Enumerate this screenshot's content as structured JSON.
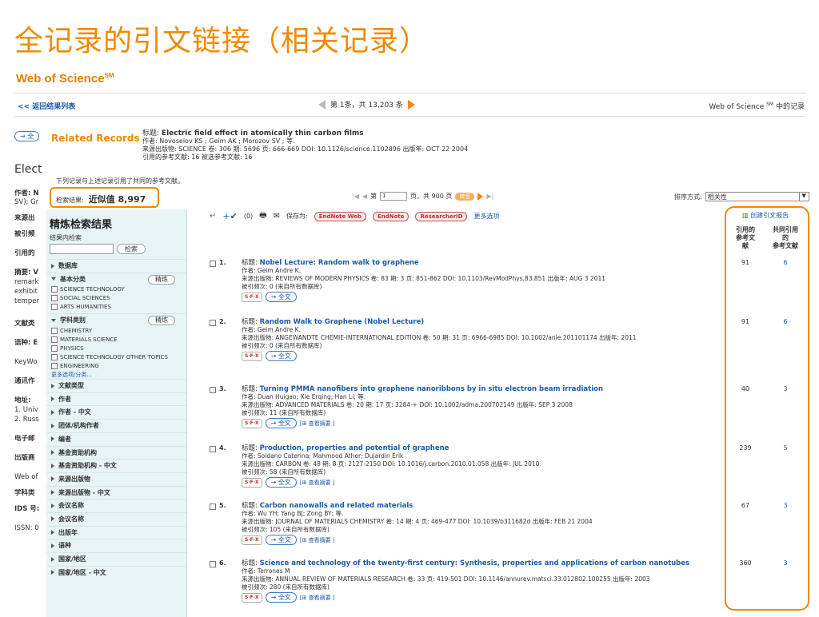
{
  "slide_title": "全记录的引文链接（相关记录）",
  "brand": {
    "name": "Web of Science",
    "mark": "SM"
  },
  "topbar": {
    "back": "<< 返回结果列表",
    "pager": "第 1条，共 13,203 条",
    "right": "Web of Science",
    "right_mark": "SM",
    "right_suffix": "中的记录"
  },
  "behind": {
    "btn": "→ 全",
    "heading": "Elect",
    "lines": [
      "作者: N",
      "SV); Gr",
      "来源出",
      "被引频",
      "引用的",
      "摘要: V",
      "remark",
      "exhibit",
      "temper",
      "文献类",
      "语种: E",
      "KeyWo",
      "通讯作",
      "地址:",
      "1. Univ",
      "2. Russ",
      "电子邮",
      "出版商",
      "Web of",
      "学科类",
      "IDS 号:",
      "ISSN: 0"
    ]
  },
  "related": {
    "label": "Related Records",
    "title_label": "标题:",
    "title": "Electric field effect in atomically thin carbon films",
    "authors": "作者: Novoselov KS ; Geim AK ; Morozov SV ; 等.",
    "source": "来源出版物: SCIENCE 卷: 306 期: 5696 页: 666-669 DOI: 10.1126/science.1102896 出版年: OCT 22 2004",
    "refs": "引用的参考文献: 16 被选参考文献: 16"
  },
  "note": "下列记录与上述记录引用了共同的参考文献。",
  "result_count": {
    "label": "检索结果:",
    "value": "近似值 8,997"
  },
  "pager2": {
    "prefix": "第",
    "page": "1",
    "suffix": "页，共 900 页",
    "go": "转至"
  },
  "sort": {
    "label": "排序方式:",
    "value": "相关性"
  },
  "sidebar": {
    "title": "精炼检索结果",
    "sub": "结果内检索",
    "search_btn": "检索",
    "refine_btn": "精炼",
    "db": "数据库",
    "basic": "基本分类",
    "basic_items": [
      "SCIENCE TECHNOLOGY",
      "SOCIAL SCIENCES",
      "ARTS HUMANITIES"
    ],
    "subject": "学科类别",
    "subject_items": [
      "CHEMISTRY",
      "MATERIALS SCIENCE",
      "PHYSICS",
      "SCIENCE TECHNOLOGY OTHER TOPICS",
      "ENGINEERING"
    ],
    "more": "更多选项/分类...",
    "facets": [
      "文献类型",
      "作者",
      "作者 - 中文",
      "团体/机构作者",
      "编者",
      "基金资助机构",
      "基金资助机构 - 中文",
      "来源出版物",
      "来源出版物 - 中文",
      "会议名称",
      "会议名称",
      "出版年",
      "语种",
      "国家/地区",
      "国家/地区 - 中文"
    ]
  },
  "toolbar": {
    "count": "(0)",
    "save_as": "保存为:",
    "endnote_web": "EndNote Web",
    "endnote": "EndNote",
    "researcherid": "ResearcherID",
    "more": "更多选项"
  },
  "columns": {
    "cite_report": "创建引文报告",
    "h1": [
      "引用的",
      "参考文",
      "献"
    ],
    "h2": [
      "共同引用",
      "的",
      "参考文献"
    ]
  },
  "records": [
    {
      "n": "1.",
      "title": "Nobel Lecture: Random walk to graphene",
      "authors": "作者: Geim Andre K.",
      "source": "来源出版物: REVIEWS OF MODERN PHYSICS 卷: 83 期: 3 页: 851-862 DOI: 10.1103/RevModPhys.83.851 出版年: AUG 3 2011",
      "cited": "被引频次: 0 (来自所有数据库)",
      "refs": "91",
      "shared": "6",
      "abstract": ""
    },
    {
      "n": "2.",
      "title": "Random Walk to Graphene (Nobel Lecture)",
      "authors": "作者: Geim Andre K.",
      "source": "来源出版物: ANGEWANDTE CHEMIE-INTERNATIONAL EDITION 卷: 50 期: 31 页: 6966-6985 DOI: 10.1002/anie.201101174 出版年: 2011",
      "cited": "被引频次: 0 (来自所有数据库)",
      "refs": "91",
      "shared": "6",
      "abstract": ""
    },
    {
      "n": "3.",
      "title": "Turning PMMA nanofibers into graphene nanoribbons by in situ electron beam irradiation",
      "authors": "作者: Duan Huigao; Xie Erqing; Han Li; 等.",
      "source": "来源出版物: ADVANCED MATERIALS 卷: 20 期: 17 页: 3284-+ DOI: 10.1002/adma.200702149 出版年: SEP 3 2008",
      "cited": "被引频次: 11 (来自所有数据库)",
      "refs": "40",
      "shared": "3",
      "abstract": "[⊞ 查看摘要 ]"
    },
    {
      "n": "4.",
      "title": "Production, properties and potential of graphene",
      "authors": "作者: Soldano Caterina; Mahmood Ather; Dujardin Erik",
      "source": "来源出版物: CARBON 卷: 48 期: 8 页: 2127-2150 DOI: 10.1016/j.carbon.2010.01.058 出版年: JUL 2010",
      "cited": "被引频次: 58 (来自所有数据库)",
      "refs": "239",
      "shared": "5",
      "abstract": "[⊞ 查看摘要 ]"
    },
    {
      "n": "5.",
      "title": "Carbon nanowalls and related materials",
      "authors": "作者: Wu YH; Yang BJ; Zong BY; 等.",
      "source": "来源出版物: JOURNAL OF MATERIALS CHEMISTRY 卷: 14 期: 4 页: 469-477 DOI: 10.1039/b311682d 出版年: FEB 21 2004",
      "cited": "被引频次: 105 (来自所有数据库)",
      "refs": "67",
      "shared": "3",
      "abstract": "[⊞ 查看摘要 ]"
    },
    {
      "n": "6.",
      "title": "Science and technology of the twenty-first century: Synthesis, properties and applications of carbon nanotubes",
      "authors": "作者: Terrones M",
      "source": "来源出版物: ANNUAL REVIEW OF MATERIALS RESEARCH 卷: 33 页: 419-501 DOI: 10.1146/annurev.matsci.33.012802.100255 出版年: 2003",
      "cited": "被引频次: 280 (来自所有数据库)",
      "refs": "360",
      "shared": "3",
      "abstract": "[⊞ 查看摘要 ]"
    }
  ],
  "full_text": "→ 全文",
  "sfx": "S·F·X"
}
